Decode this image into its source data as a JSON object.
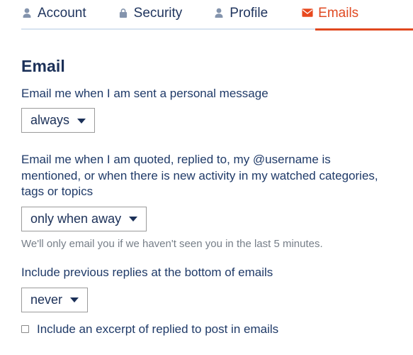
{
  "tabs": [
    {
      "id": "account",
      "label": "Account",
      "icon": "user-icon",
      "active": false
    },
    {
      "id": "security",
      "label": "Security",
      "icon": "lock-icon",
      "active": false
    },
    {
      "id": "profile",
      "label": "Profile",
      "icon": "user-icon",
      "active": false
    },
    {
      "id": "emails",
      "label": "Emails",
      "icon": "envelope-icon",
      "active": true
    }
  ],
  "colors": {
    "accent": "#e0481e",
    "text": "#1f3a68",
    "heading": "#1b3058",
    "muted": "#767e88",
    "tab_icon": "#8494ad",
    "tab_border": "#d7e3f0",
    "select_border": "#9b9b9b"
  },
  "main": {
    "section_title": "Email",
    "fields": [
      {
        "id": "personal-message",
        "label": "Email me when I am sent a personal message",
        "value": "always",
        "helper": ""
      },
      {
        "id": "mentions-activity",
        "label": "Email me when I am quoted, replied to, my @username is mentioned, or when there is new activity in my watched categories, tags or topics",
        "value": "only when away",
        "helper": "We'll only email you if we haven't seen you in the last 5 minutes."
      },
      {
        "id": "previous-replies",
        "label": "Include previous replies at the bottom of emails",
        "value": "never",
        "helper": ""
      }
    ],
    "checkbox": {
      "id": "include-excerpt",
      "label": "Include an excerpt of replied to post in emails",
      "checked": false
    }
  }
}
